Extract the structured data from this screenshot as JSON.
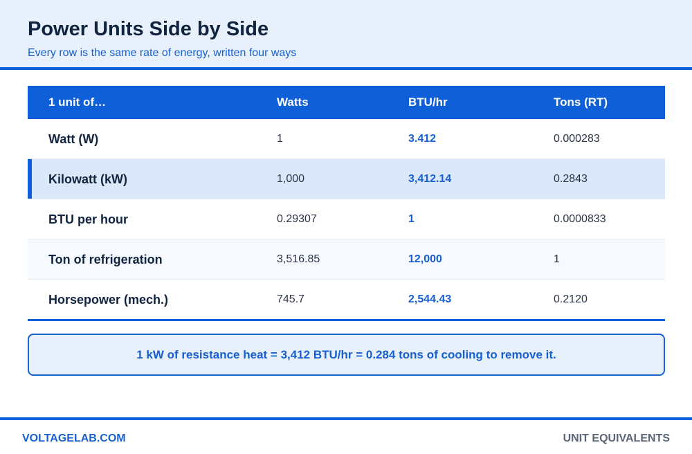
{
  "header": {
    "title": "Power Units Side by Side",
    "subtitle": "Every row is the same rate of energy, written four ways"
  },
  "table": {
    "columns": [
      "1 unit of…",
      "Watts",
      "BTU/hr",
      "Tons (RT)"
    ],
    "rows": [
      {
        "unit": "Watt (W)",
        "watts": "1",
        "btu_hr": "3.412",
        "tons": "0.000283"
      },
      {
        "unit": "Kilowatt (kW)",
        "watts": "1,000",
        "btu_hr": "3,412.14",
        "tons": "0.2843"
      },
      {
        "unit": "BTU per hour",
        "watts": "0.29307",
        "btu_hr": "1",
        "tons": "0.0000833"
      },
      {
        "unit": "Ton of refrigeration",
        "watts": "3,516.85",
        "btu_hr": "12,000",
        "tons": "1"
      },
      {
        "unit": "Horsepower (mech.)",
        "watts": "745.7",
        "btu_hr": "2,544.43",
        "tons": "0.2120"
      }
    ],
    "highlighted_row": "Kilowatt (kW)"
  },
  "callout": {
    "text": "1 kW of resistance heat = 3,412 BTU/hr = 0.284 tons of cooling to remove it."
  },
  "footer": {
    "brand": "VOLTAGELAB.COM",
    "tag": "UNIT EQUIVALENTS"
  },
  "colors": {
    "accent": "#0f5fd8",
    "header_bg": "#e8f0fc",
    "highlight_row_bg": "#dbe8fa"
  }
}
